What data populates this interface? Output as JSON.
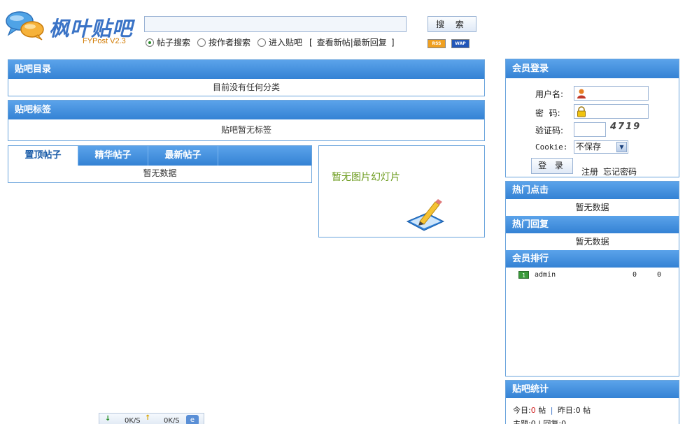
{
  "header": {
    "logo_title": "枫叶贴吧",
    "logo_version": "FYPost  V2.3",
    "search_value": "",
    "search_button": "搜 索",
    "radios": [
      {
        "label": "帖子搜索",
        "checked": true
      },
      {
        "label": "按作者搜索",
        "checked": false
      },
      {
        "label": "进入贴吧",
        "checked": false
      }
    ],
    "quick_links": {
      "open": "[",
      "new_posts": "查看新帖",
      "sep": "|",
      "new_replies": "最新回复",
      "close": "]"
    },
    "rss_badge": "RSS",
    "wap_badge": "WAP"
  },
  "directory": {
    "title": "贴吧目录",
    "body": "目前没有任何分类"
  },
  "tags": {
    "title": "贴吧标签",
    "body": "贴吧暂无标签"
  },
  "posts": {
    "tabs": [
      {
        "label": "置顶帖子",
        "active": true
      },
      {
        "label": "精华帖子",
        "active": false
      },
      {
        "label": "最新帖子",
        "active": false
      }
    ],
    "body": "暂无数据"
  },
  "slideshow": {
    "text": "暂无图片幻灯片"
  },
  "login": {
    "title": "会员登录",
    "username_label": "用户名:",
    "password_label": "密  码:",
    "captcha_label": "验证码:",
    "captcha_image_text": "4719",
    "cookie_label": "Cookie:",
    "cookie_value": "不保存",
    "login_button": "登 录",
    "register_link": "注册",
    "forgot_link": "忘记密码"
  },
  "hot_clicks": {
    "title": "热门点击",
    "body": "暂无数据"
  },
  "hot_replies": {
    "title": "热门回复",
    "body": "暂无数据"
  },
  "ranking": {
    "title": "会员排行",
    "rows": [
      {
        "rank": "1",
        "name": "admin",
        "col1": "0",
        "col2": "0"
      }
    ]
  },
  "stats": {
    "title": "贴吧统计",
    "today_label": "今日:",
    "today_value": "0",
    "unit": "帖",
    "sep": "|",
    "yesterday_label": "昨日:",
    "yesterday_value": "0",
    "line2": "主题:0  |  回复:0"
  },
  "speed_bar": {
    "down": "0K/S",
    "up": "0K/S"
  },
  "colors": {
    "header_blue": "#3482d4",
    "border": "#6aa4dc",
    "accent_orange": "#d17a00",
    "accent_green": "#6a9a1a"
  }
}
